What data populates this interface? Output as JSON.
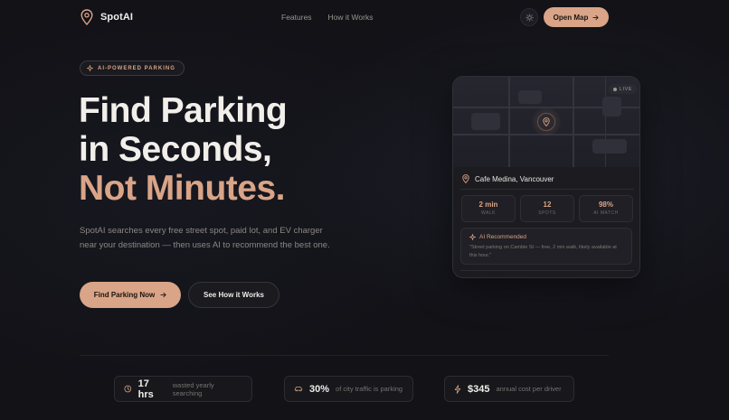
{
  "nav": {
    "brand": "SpotAI",
    "links": [
      "Features",
      "How it Works"
    ],
    "theme_icon": "sun-icon",
    "open_map_label": "Open Map"
  },
  "hero": {
    "badge": "AI-POWERED PARKING",
    "headline_line1": "Find Parking",
    "headline_line2": "in Seconds,",
    "headline_line3": "Not Minutes.",
    "description": "SpotAI searches every free street spot, paid lot, and EV charger near your destination — then uses AI to recommend the best one.",
    "cta_primary": "Find Parking Now",
    "cta_secondary": "See How it Works"
  },
  "card": {
    "live": "LIVE",
    "location": "Cafe Medina, Vancouver",
    "stats": [
      {
        "value": "2 min",
        "label": "WALK"
      },
      {
        "value": "12",
        "label": "SPOTS"
      },
      {
        "value": "98%",
        "label": "AI MATCH"
      }
    ],
    "ai_title": "AI Recommended",
    "ai_text": "\"Street parking on Cambie St — free, 2 min walk, likely available at this hour.\""
  },
  "strip": [
    {
      "icon": "clock-icon",
      "value": "17 hrs",
      "desc": "wasted yearly searching"
    },
    {
      "icon": "car-icon",
      "value": "30%",
      "desc": "of city traffic is parking"
    },
    {
      "icon": "bolt-icon",
      "value": "$345",
      "desc": "annual cost per driver"
    }
  ],
  "colors": {
    "accent": "#d9a487",
    "background": "#121217"
  }
}
